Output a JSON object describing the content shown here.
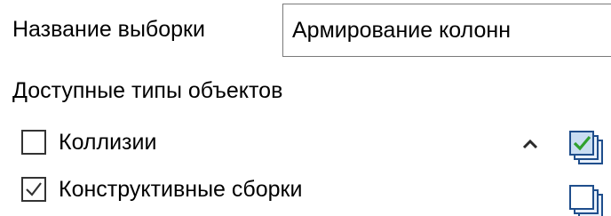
{
  "form": {
    "name_label": "Название выборки",
    "name_value": "Армирование колонн",
    "types_label": "Доступные типы объектов"
  },
  "object_types": [
    {
      "label": "Коллизии",
      "checked": false
    },
    {
      "label": "Конструктивные сборки",
      "checked": true
    }
  ],
  "icons": {
    "scroll_up": "chevron-up-icon",
    "check_all": "check-all-stack-icon",
    "uncheck_all": "uncheck-all-stack-icon"
  },
  "colors": {
    "checkmark": "#333333",
    "stack_icon_border": "#1f4e8c",
    "stack_icon_fill": "#c9ddf2",
    "stack_icon_check": "#2fa12f"
  }
}
